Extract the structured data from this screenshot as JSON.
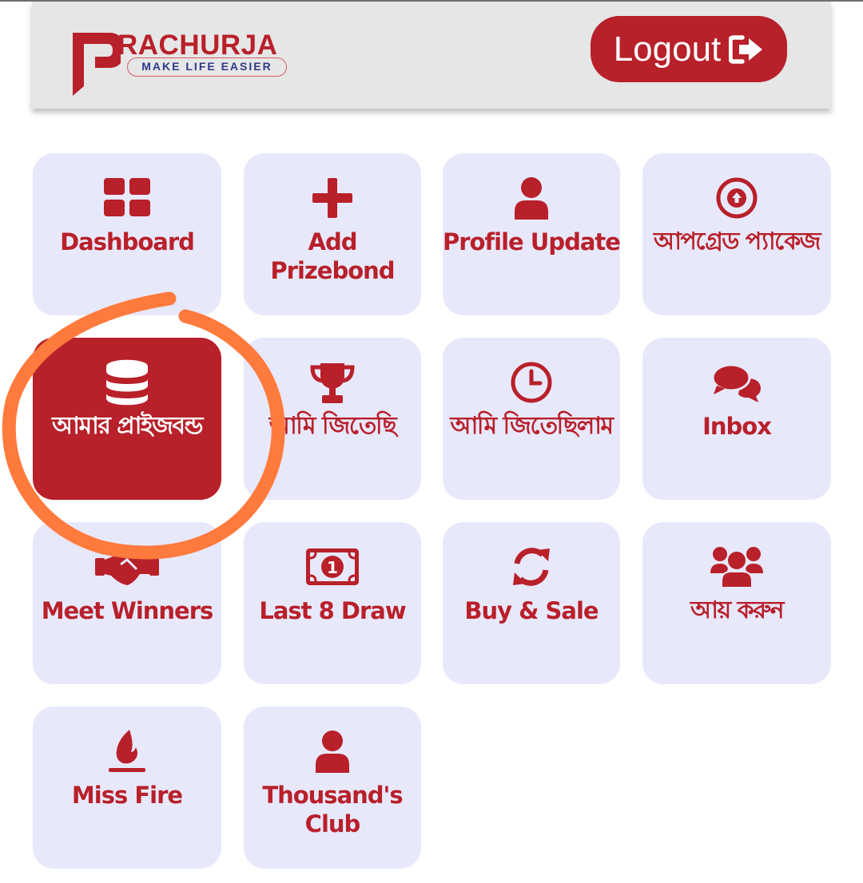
{
  "header": {
    "brand_name": "RACHURJA",
    "tagline": "MAKE LIFE EASIER",
    "logout_label": "Logout"
  },
  "tiles": [
    {
      "label": "Dashboard",
      "icon": "dashboard-grid-icon"
    },
    {
      "label": "Add Prizebond",
      "icon": "plus-icon"
    },
    {
      "label": "Profile Update",
      "icon": "user-icon"
    },
    {
      "label": "আপগ্রেড প্যাকেজ",
      "icon": "arrow-up-circle-icon"
    },
    {
      "label": "আমার প্রাইজবন্ড",
      "icon": "database-icon",
      "active": true
    },
    {
      "label": "আমি জিতেছি",
      "icon": "trophy-icon"
    },
    {
      "label": "আমি জিতেছিলাম",
      "icon": "clock-icon"
    },
    {
      "label": "Inbox",
      "icon": "comments-icon"
    },
    {
      "label": "Meet Winners",
      "icon": "handshake-icon"
    },
    {
      "label": "Last 8 Draw",
      "icon": "money-bill-icon"
    },
    {
      "label": "Buy & Sale",
      "icon": "sync-icon"
    },
    {
      "label": "আয় করুন",
      "icon": "users-icon"
    },
    {
      "label": "Miss Fire",
      "icon": "fire-icon"
    },
    {
      "label": "Thousand's\nClub",
      "icon": "user-icon"
    }
  ],
  "colors": {
    "brand_red": "#b8202a",
    "tile_bg": "#e8e8fb",
    "header_bg": "#e6e6e6",
    "tagline_blue": "#2c3a8a",
    "annotation_orange": "#ff7a3d"
  }
}
